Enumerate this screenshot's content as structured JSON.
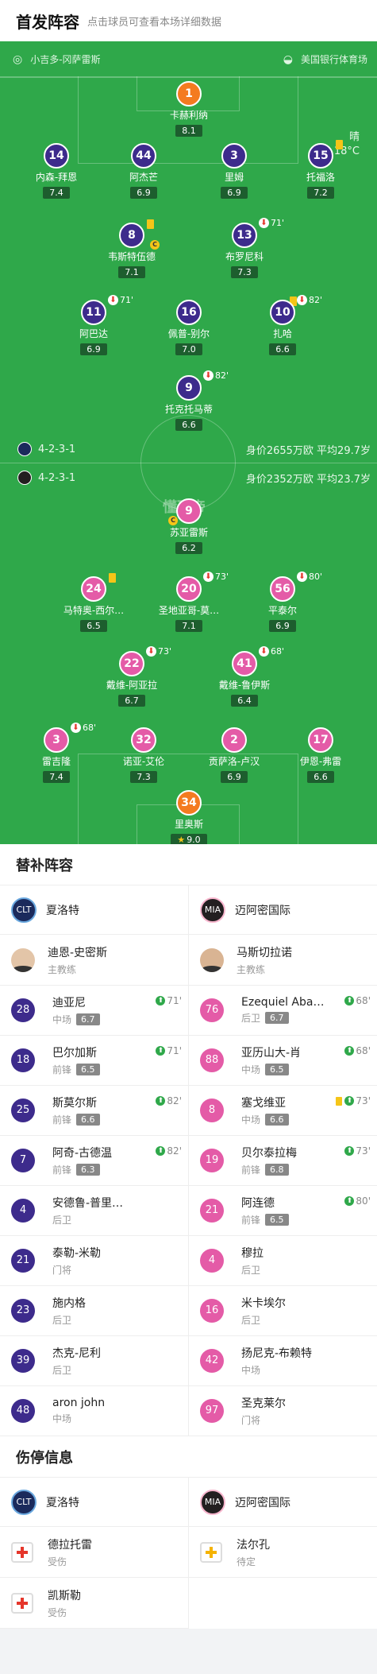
{
  "header": {
    "title": "首发阵容",
    "subtitle": "点击球员可查看本场详细数据"
  },
  "pitch": {
    "referee": "小吉多-冈萨雷斯",
    "stadium": "美国银行体育场",
    "weather": "晴",
    "temperature": "18°C",
    "watermark": "懂球帝",
    "home": {
      "formation": "4-2-3-1",
      "value": "身价2655万欧 平均29.7岁"
    },
    "away": {
      "formation": "4-2-3-1",
      "value": "身价2352万欧 平均23.7岁"
    },
    "home_players": [
      {
        "num": "1",
        "name": "卡赫利纳",
        "rating": "8.1"
      },
      {
        "num": "14",
        "name": "内森-拜恩",
        "rating": "7.4"
      },
      {
        "num": "44",
        "name": "阿杰芒",
        "rating": "6.9"
      },
      {
        "num": "3",
        "name": "里姆",
        "rating": "6.9"
      },
      {
        "num": "15",
        "name": "托福洛",
        "rating": "7.2"
      },
      {
        "num": "8",
        "name": "韦斯特伍德",
        "rating": "7.1"
      },
      {
        "num": "13",
        "name": "布罗尼科",
        "rating": "7.3",
        "sub": "71'"
      },
      {
        "num": "11",
        "name": "阿巴达",
        "rating": "6.9",
        "sub": "71'"
      },
      {
        "num": "16",
        "name": "佩普-别尔",
        "rating": "7.0"
      },
      {
        "num": "10",
        "name": "扎哈",
        "rating": "6.6",
        "sub": "82'"
      },
      {
        "num": "9",
        "name": "托克托马蒂",
        "rating": "6.6",
        "sub": "82'"
      }
    ],
    "away_players": [
      {
        "num": "9",
        "name": "苏亚雷斯",
        "rating": "6.2"
      },
      {
        "num": "24",
        "name": "马特奥-西尔…",
        "rating": "6.5"
      },
      {
        "num": "20",
        "name": "圣地亚哥-莫…",
        "rating": "7.1",
        "sub": "73'"
      },
      {
        "num": "56",
        "name": "平泰尔",
        "rating": "6.9",
        "sub": "80'"
      },
      {
        "num": "22",
        "name": "戴维-阿亚拉",
        "rating": "6.7",
        "sub": "73'"
      },
      {
        "num": "41",
        "name": "戴维-鲁伊斯",
        "rating": "6.4",
        "sub": "68'"
      },
      {
        "num": "3",
        "name": "雷吉隆",
        "rating": "7.4",
        "sub": "68'"
      },
      {
        "num": "32",
        "name": "诺亚-艾伦",
        "rating": "7.3"
      },
      {
        "num": "2",
        "name": "贡萨洛-卢汉",
        "rating": "6.9"
      },
      {
        "num": "17",
        "name": "伊恩-弗雷",
        "rating": "6.6"
      },
      {
        "num": "34",
        "name": "里奥斯",
        "rating": "9.0"
      }
    ],
    "captain_mark": "C",
    "goal_mark": "★"
  },
  "subs": {
    "title": "替补阵容",
    "home": {
      "team": "夏洛特",
      "logo": "CLT",
      "coach": "迪恩-史密斯",
      "coach_role": "主教练",
      "players": [
        {
          "num": "28",
          "name": "迪亚尼",
          "pos": "中场",
          "rating": "6.7",
          "in": "71'"
        },
        {
          "num": "18",
          "name": "巴尔加斯",
          "pos": "前锋",
          "rating": "6.5",
          "in": "71'"
        },
        {
          "num": "25",
          "name": "斯莫尔斯",
          "pos": "前锋",
          "rating": "6.6",
          "in": "82'"
        },
        {
          "num": "7",
          "name": "阿奇-古德温",
          "pos": "前锋",
          "rating": "6.3",
          "in": "82'"
        },
        {
          "num": "4",
          "name": "安德鲁-普里…",
          "pos": "后卫"
        },
        {
          "num": "21",
          "name": "泰勒-米勒",
          "pos": "门将"
        },
        {
          "num": "23",
          "name": "施内格",
          "pos": "后卫"
        },
        {
          "num": "39",
          "name": "杰克-尼利",
          "pos": "后卫"
        },
        {
          "num": "48",
          "name": "aron john",
          "pos": "中场"
        }
      ]
    },
    "away": {
      "team": "迈阿密国际",
      "logo": "MIA",
      "coach": "马斯切拉诺",
      "coach_role": "主教练",
      "players": [
        {
          "num": "76",
          "name": "Ezequiel Aba…",
          "pos": "后卫",
          "rating": "6.7",
          "in": "68'"
        },
        {
          "num": "88",
          "name": "亚历山大-肖",
          "pos": "中场",
          "rating": "6.5",
          "in": "68'"
        },
        {
          "num": "8",
          "name": "塞戈维亚",
          "pos": "中场",
          "rating": "6.6",
          "in": "73'"
        },
        {
          "num": "19",
          "name": "贝尔泰拉梅",
          "pos": "前锋",
          "rating": "6.8",
          "in": "73'"
        },
        {
          "num": "21",
          "name": "阿连德",
          "pos": "前锋",
          "rating": "6.5",
          "in": "80'"
        },
        {
          "num": "4",
          "name": "穆拉",
          "pos": "后卫"
        },
        {
          "num": "16",
          "name": "米卡埃尔",
          "pos": "后卫"
        },
        {
          "num": "42",
          "name": "扬尼克-布赖特",
          "pos": "中场"
        },
        {
          "num": "97",
          "name": "圣克莱尔",
          "pos": "门将"
        }
      ]
    }
  },
  "injuries": {
    "title": "伤停信息",
    "home": {
      "team": "夏洛特",
      "players": [
        {
          "name": "德拉托雷",
          "status": "受伤"
        },
        {
          "name": "凯斯勒",
          "status": "受伤"
        }
      ]
    },
    "away": {
      "team": "迈阿密国际",
      "players": [
        {
          "name": "法尔孔",
          "status": "待定"
        }
      ]
    }
  },
  "colors": {
    "pitch": "#2fa84a",
    "home": "#3d2b8c",
    "away": "#e45ba7",
    "gk": "#f47b20"
  }
}
